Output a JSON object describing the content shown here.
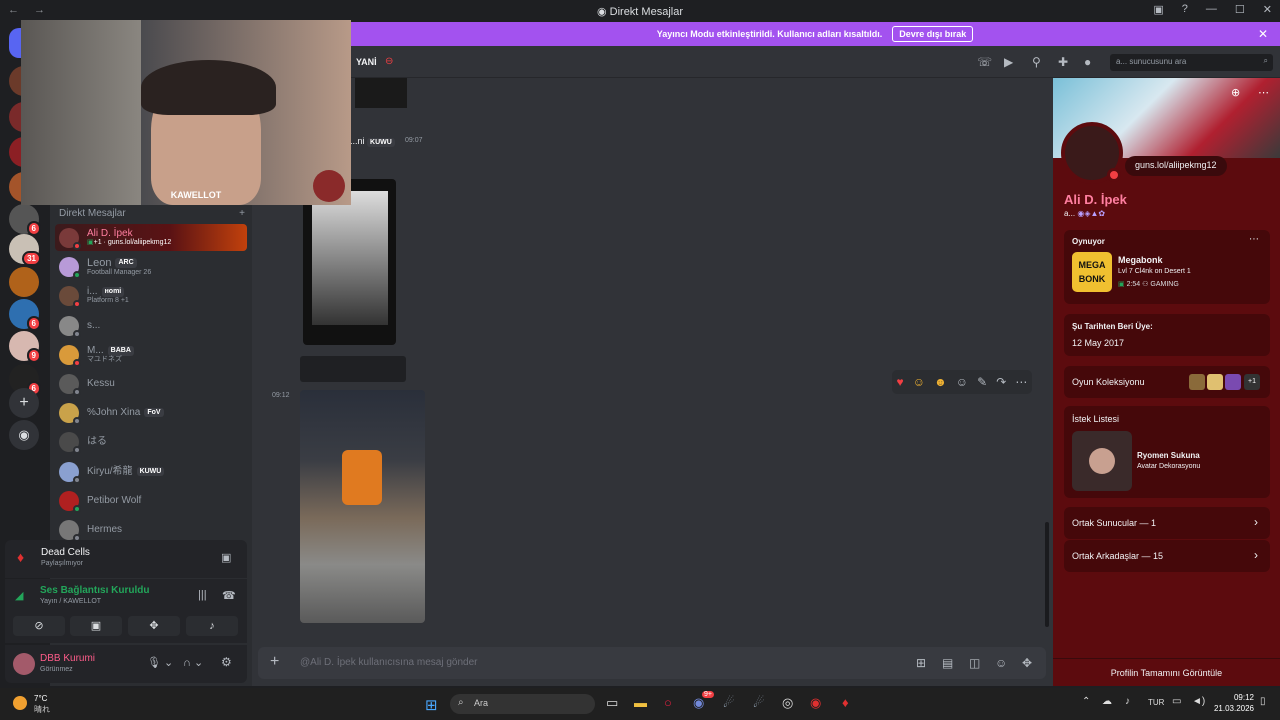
{
  "window": {
    "title": "Direkt Mesajlar"
  },
  "banner": {
    "text": "Yayıncı Modu etkinleştirildi. Kullanıcı adları kısaltıldı.",
    "button": "Devre dışı bırak"
  },
  "channel": {
    "name": "YANİ",
    "search_placeholder": "a... sunucusunu ara"
  },
  "webcam": {
    "overlay_name": "KAWELLOT"
  },
  "rail": {
    "badges": [
      "6",
      "31",
      "6",
      "9",
      "6"
    ]
  },
  "sidebar": {
    "dm_header": "Direkt Mesajlar",
    "dms": [
      {
        "name": "Ali D. İpek",
        "sub": "guns.lol/aliipekmg12",
        "sub_prefix": "+1",
        "tag": "",
        "selected": true,
        "status": "dnd"
      },
      {
        "name": "Leon",
        "tag": "ARC",
        "sub": "Football Manager 26",
        "status": "online"
      },
      {
        "name": "i...",
        "tag": "нomi",
        "sub": "Platform 8 +1",
        "status": "dnd"
      },
      {
        "name": "s...",
        "tag": "",
        "sub": "",
        "status": "offline"
      },
      {
        "name": "M...",
        "tag": "BABA",
        "sub": "マユドネズ",
        "status": "dnd"
      },
      {
        "name": "Kessu",
        "tag": "",
        "sub": "",
        "status": "offline"
      },
      {
        "name": "%John Xina",
        "tag": "FoV",
        "sub": "",
        "status": "offline"
      },
      {
        "name": "はる",
        "tag": "",
        "sub": "",
        "status": "offline"
      },
      {
        "name": "Kiryu/希龍",
        "tag": "KUWU",
        "sub": "",
        "status": "offline"
      },
      {
        "name": "Petibor Wolf",
        "tag": "",
        "sub": "",
        "status": "online"
      },
      {
        "name": "Hermes",
        "tag": "",
        "sub": "",
        "status": "offline"
      }
    ]
  },
  "activity": {
    "game": "Dead Cells",
    "game_sub": "Paylaşılmıyor",
    "voice_title": "Ses Bağlantısı Kuruldu",
    "voice_sub": "Yayın / KAWELLOT"
  },
  "user": {
    "name": "DBB Kurumi",
    "status": "Görünmez"
  },
  "messages": {
    "msg1_author": "...ni",
    "msg1_tag": "KUWU",
    "msg1_time": "09:07",
    "msg2_time": "09:12",
    "composer_placeholder": "@Ali D. İpek kullanıcısına mesaj gönder"
  },
  "profile": {
    "name": "Ali D. İpek",
    "handle_prefix": "a...",
    "bio_link": "guns.lol/aliipekmg12",
    "playing_label": "Oynuyor",
    "game_title": "Megabonk",
    "game_detail": "Lvl 7 Cl4nk on Desert 1",
    "game_time": "2:54",
    "game_badge": "GAMING",
    "game_icon_text": "MEGA BONK",
    "member_since_label": "Şu Tarihten Beri Üye:",
    "member_since": "12 May 2017",
    "game_collection": "Oyun Koleksiyonu",
    "collection_more": "+1",
    "wishlist_label": "İstek Listesi",
    "wish_item": "Ryomen Sukuna",
    "wish_sub": "Avatar Dekorasyonu",
    "mutual_servers": "Ortak Sunucular — 1",
    "mutual_friends": "Ortak Arkadaşlar — 15",
    "view_full": "Profilin Tamamını Görüntüle"
  },
  "taskbar": {
    "weather_temp": "7°C",
    "weather_text": "晴れ",
    "search": "Ara",
    "lang": "TUR",
    "time": "09:12",
    "date": "21.03.2026",
    "discord_badge": "9+"
  },
  "colors": {
    "accent": "#a352ef",
    "profile_bg": "#5c0b0e",
    "dnd": "#f23f43",
    "online": "#23a55a"
  }
}
